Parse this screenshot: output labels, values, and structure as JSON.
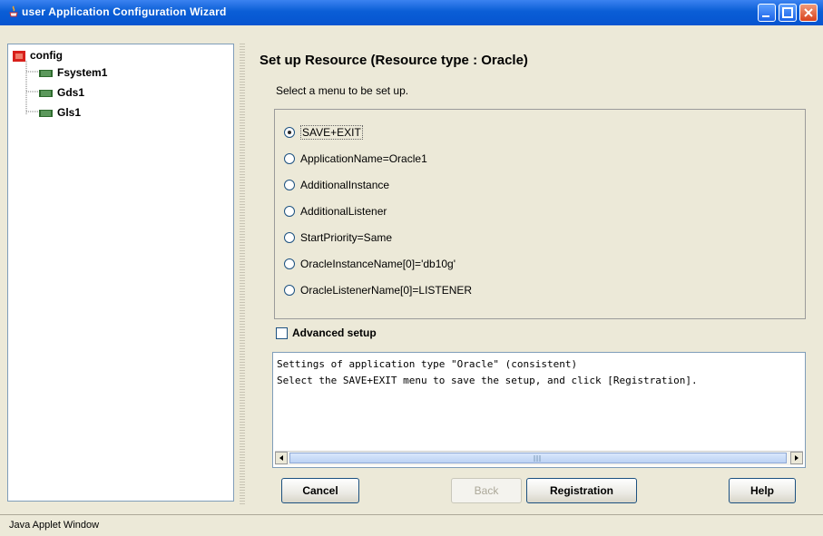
{
  "window": {
    "title": "user Application Configuration Wizard"
  },
  "tree": {
    "root": "config",
    "items": [
      "Fsystem1",
      "Gds1",
      "Gls1"
    ]
  },
  "header": {
    "title": "Set up Resource (Resource type : Oracle)",
    "subtitle": "Select a menu to be set up."
  },
  "options": [
    {
      "label": "SAVE+EXIT",
      "selected": true
    },
    {
      "label": "ApplicationName=Oracle1",
      "selected": false
    },
    {
      "label": "AdditionalInstance",
      "selected": false
    },
    {
      "label": "AdditionalListener",
      "selected": false
    },
    {
      "label": "StartPriority=Same",
      "selected": false
    },
    {
      "label": "OracleInstanceName[0]='db10g'",
      "selected": false
    },
    {
      "label": "OracleListenerName[0]=LISTENER",
      "selected": false
    }
  ],
  "advanced_setup": {
    "label": "Advanced setup",
    "checked": false
  },
  "messages": [
    "Settings of application type \"Oracle\" (consistent)",
    "Select the SAVE+EXIT menu to save the setup, and click [Registration]."
  ],
  "buttons": {
    "cancel": "Cancel",
    "back": "Back",
    "registration": "Registration",
    "help": "Help"
  },
  "status": "Java Applet Window",
  "colors": {
    "titlebar": "#0a5ed6",
    "background": "#ece9d8",
    "tree_node_icon": "#2e6b2e",
    "root_icon": "#d8201b"
  }
}
